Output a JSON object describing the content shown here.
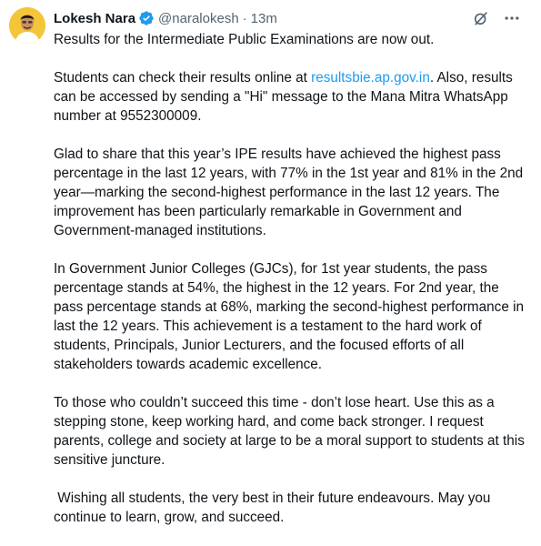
{
  "tweet": {
    "author_name": "Lokesh Nara",
    "handle": "@naralokesh",
    "separator": "·",
    "time": "13m",
    "icons": {
      "verified": "verified-badge-icon",
      "grok": "grok-icon",
      "more": "more-options-icon"
    },
    "accent_color": "#1d9bf0",
    "p1": "Results for the Intermediate Public Examinations are now out.",
    "p2_before": "Students can check their results online at ",
    "p2_link": "resultsbie.ap.gov.in",
    "p2_after": ". Also, results can be accessed by sending a \"Hi\" message to the Mana Mitra WhatsApp number at 9552300009.",
    "p3": "Glad to share that this year’s IPE results have achieved the highest pass percentage in the last 12 years, with 77% in the 1st year and 81% in the 2nd year—marking the second-highest performance in the last 12 years. The improvement has been particularly remarkable in Government and Government-managed institutions.",
    "p4": "In Government Junior Colleges (GJCs), for 1st year students, the pass percentage stands at 54%, the highest in the 12 years. For 2nd year, the pass percentage stands at 68%, marking the second-highest performance in last the 12 years. This achievement is a testament to the hard work of students, Principals, Junior Lecturers, and the focused efforts of all stakeholders towards academic excellence.",
    "p5": "To those who couldn’t succeed this time - don’t lose heart. Use this as a stepping stone, keep working hard, and come back stronger. I request parents, college and society at large to be a moral support to students at this sensitive juncture.",
    "p6": " Wishing all students, the very best in their future endeavours. May you continue to learn, grow, and succeed."
  }
}
